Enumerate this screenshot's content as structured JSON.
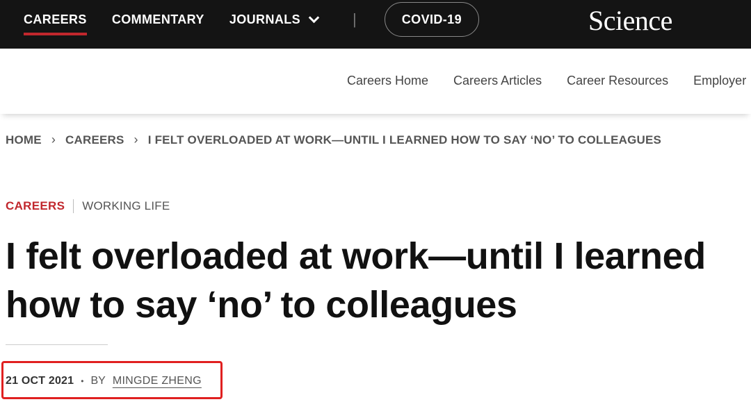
{
  "topnav": {
    "items": [
      {
        "label": "CAREERS",
        "active": true
      },
      {
        "label": "COMMENTARY",
        "active": false
      },
      {
        "label": "JOURNALS",
        "active": false,
        "icon": "chevron-down-icon"
      }
    ],
    "separator": "|",
    "covid_label": "COVID-19",
    "logo_text": "Science"
  },
  "subnav": {
    "links": [
      "Careers Home",
      "Careers Articles",
      "Career Resources",
      "Employer"
    ]
  },
  "breadcrumb": {
    "items": [
      "HOME",
      "CAREERS",
      "I FELT OVERLOADED AT WORK—UNTIL I LEARNED HOW TO SAY ‘NO’ TO COLLEAGUES"
    ],
    "separator_icon": "chevron-right-icon"
  },
  "article": {
    "category": "CAREERS",
    "subcategory": "WORKING LIFE",
    "title_line1": "I felt overloaded at work—until I learned",
    "title_line2": "how to say ‘no’ to colleagues",
    "date": "21 OCT 2021",
    "by_label": "BY",
    "author": "MINGDE ZHENG"
  },
  "colors": {
    "topbar_bg": "#141414",
    "accent_red": "#c1272d",
    "highlight_box": "#e02020"
  }
}
